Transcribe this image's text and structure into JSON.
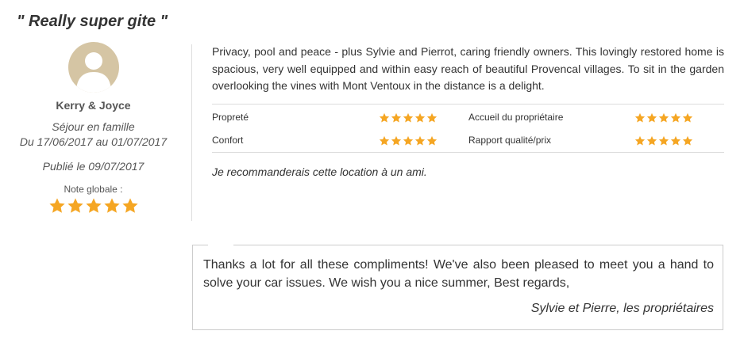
{
  "review": {
    "title": "\" Really super gite \"",
    "author": "Kerry & Joyce",
    "stay_type": "Séjour en famille",
    "stay_dates": "Du 17/06/2017 au 01/07/2017",
    "published": "Publié le 09/07/2017",
    "overall_label": "Note globale :",
    "overall_stars": 5,
    "text": "Privacy, pool and peace - plus Sylvie and Pierrot, caring friendly owners. This lovingly restored home is spacious, very well equipped and within easy reach of beautiful Provencal villages. To sit in the garden overlooking the vines with Mont Ventoux in the distance is a delight.",
    "ratings": [
      {
        "label": "Propreté",
        "stars": 5
      },
      {
        "label": "Accueil du propriétaire",
        "stars": 5
      },
      {
        "label": "Confort",
        "stars": 5
      },
      {
        "label": "Rapport qualité/prix",
        "stars": 5
      }
    ],
    "recommendation": "Je recommanderais cette location à un ami."
  },
  "reply": {
    "text": "Thanks a lot for all these compliments! We've also been pleased to meet you a hand to solve your car issues. We wish you a nice summer, Best regards,",
    "signature": "Sylvie et Pierre, les propriétaires"
  },
  "colors": {
    "star": "#f5a623",
    "avatar_bg": "#d5c5a4",
    "border": "#dddddd"
  },
  "icons": {
    "avatar": "user-silhouette-icon",
    "star": "star-icon"
  }
}
